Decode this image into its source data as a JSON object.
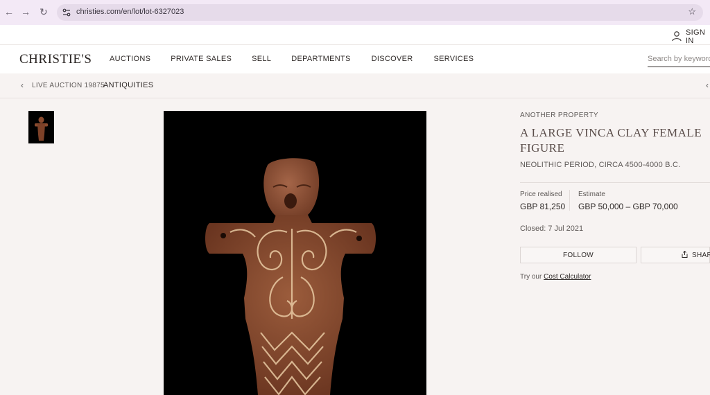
{
  "browser": {
    "url": "christies.com/en/lot/lot-6327023"
  },
  "account": {
    "signin_label": "SIGN IN"
  },
  "header": {
    "logo": "CHRISTIE'S",
    "menu": [
      "AUCTIONS",
      "PRIVATE SALES",
      "SELL",
      "DEPARTMENTS",
      "DISCOVER",
      "SERVICES"
    ],
    "search_placeholder": "Search by keyword"
  },
  "breadcrumb": {
    "auction": "LIVE AUCTION 19875",
    "department": "ANTIQUITIES"
  },
  "lot": {
    "provenance": "ANOTHER PROPERTY",
    "title": "A LARGE VINCA CLAY FEMALE FIGURE",
    "period": "NEOLITHIC PERIOD, CIRCA 4500-4000 B.C.",
    "price_label": "Price realised",
    "price_value": "GBP 81,250",
    "estimate_label": "Estimate",
    "estimate_value": "GBP 50,000 – GBP 70,000",
    "closed": "Closed: 7 Jul 2021",
    "follow_label": "FOLLOW",
    "share_label": "SHARE",
    "calc_prefix": "Try our",
    "calc_link": "Cost Calculator"
  },
  "colors": {
    "page_bg": "#f7f3f2",
    "chrome_bg": "#f3e9f6",
    "image_bg": "#000000",
    "title_text": "#5a4d4a"
  }
}
